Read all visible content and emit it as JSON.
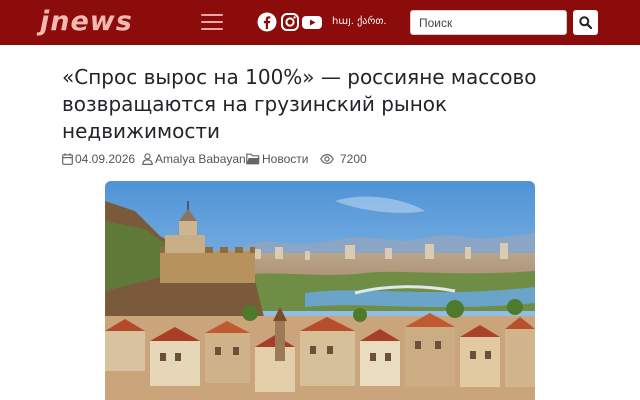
{
  "header": {
    "logo_text": "JNEWS",
    "menu_icon": "hamburger-menu-icon",
    "social_icons": [
      "facebook-icon",
      "instagram-icon",
      "youtube-icon"
    ],
    "language_switch": "հայ. ქართ.",
    "search": {
      "placeholder": "Поиск",
      "button_icon": "search-icon"
    },
    "colors": {
      "header_bg": "#8c0b0b",
      "logo": "#f3b8b0"
    }
  },
  "article": {
    "title": "«Спрос вырос на 100%» — россияне массово возвращаются на грузинский рынок недвижимости",
    "meta": {
      "date": "04.09.2026",
      "author": "Amalya Babayan",
      "category": "Новости",
      "views": "7200"
    },
    "meta_icons": [
      "calendar-icon",
      "user-icon",
      "folder-icon",
      "eye-icon"
    ],
    "hero_image": "tbilisi-old-town-panorama"
  }
}
